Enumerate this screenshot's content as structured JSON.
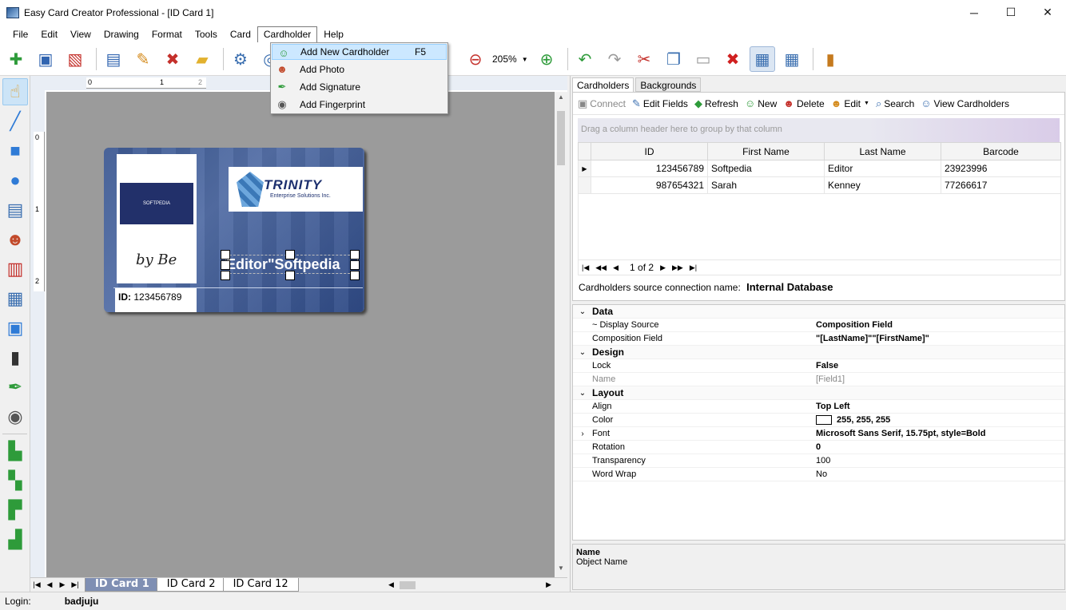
{
  "window": {
    "title": "Easy Card Creator Professional - [ID Card 1]",
    "controls": [
      "─",
      "☐",
      "✕"
    ]
  },
  "menu": [
    "File",
    "Edit",
    "View",
    "Drawing",
    "Format",
    "Tools",
    "Card",
    "Cardholder",
    "Help"
  ],
  "toolbar": {
    "zoom": "205%"
  },
  "cardholder_menu": {
    "items": [
      {
        "label": "Add New Cardholder",
        "shortcut": "F5"
      },
      {
        "label": "Add Photo",
        "shortcut": ""
      },
      {
        "label": "Add Signature",
        "shortcut": ""
      },
      {
        "label": "Add Fingerprint",
        "shortcut": ""
      }
    ]
  },
  "card": {
    "photo_text": "SOFTPEDIA",
    "signature": "by Be",
    "id_label": "ID:",
    "id_value": "123456789",
    "logo_title": "TRINITY",
    "logo_subtitle": "Enterprise Solutions Inc.",
    "name_field": "Editor\"Softpedia"
  },
  "card_tabs": [
    "ID Card 1",
    "ID Card 2",
    "ID Card 12"
  ],
  "status": {
    "login_label": "Login:",
    "user": "badjuju"
  },
  "right_tabs": [
    "Cardholders",
    "Backgrounds"
  ],
  "cardholders": {
    "toolbar": [
      "Connect",
      "Edit Fields",
      "Refresh",
      "New",
      "Delete",
      "Edit",
      "Search",
      "View Cardholders"
    ],
    "group_hint": "Drag a column header here to group by that column",
    "columns": [
      "ID",
      "First Name",
      "Last Name",
      "Barcode"
    ],
    "rows": [
      {
        "id": "123456789",
        "first": "Softpedia",
        "last": "Editor",
        "barcode": "23923996"
      },
      {
        "id": "987654321",
        "first": "Sarah",
        "last": "Kenney",
        "barcode": "77266617"
      }
    ],
    "pager": "1 of 2",
    "source_label": "Cardholders source connection name:",
    "source_value": "Internal Database"
  },
  "properties": {
    "groups": [
      {
        "name": "Data",
        "rows": [
          {
            "name": "~ Display Source",
            "value": "Composition Field"
          },
          {
            "name": "Composition Field",
            "value": "\"[LastName]\"\"[FirstName]\""
          }
        ]
      },
      {
        "name": "Design",
        "rows": [
          {
            "name": "Lock",
            "value": "False"
          },
          {
            "name": "Name",
            "value": "[Field1]"
          }
        ]
      },
      {
        "name": "Layout",
        "rows": [
          {
            "name": "Align",
            "value": "Top Left"
          },
          {
            "name": "Color",
            "value": "255, 255, 255"
          },
          {
            "name": "Font",
            "value": "Microsoft Sans Serif, 15.75pt, style=Bold"
          },
          {
            "name": "Rotation",
            "value": "0"
          },
          {
            "name": "Transparency",
            "value": "100"
          },
          {
            "name": "Word Wrap",
            "value": "No"
          }
        ]
      }
    ]
  },
  "description": {
    "title": "Name",
    "text": "Object Name"
  },
  "ruler": {
    "h_ticks": [
      "0",
      "1",
      "2"
    ],
    "v_ticks": [
      "0",
      "1",
      "2"
    ]
  }
}
